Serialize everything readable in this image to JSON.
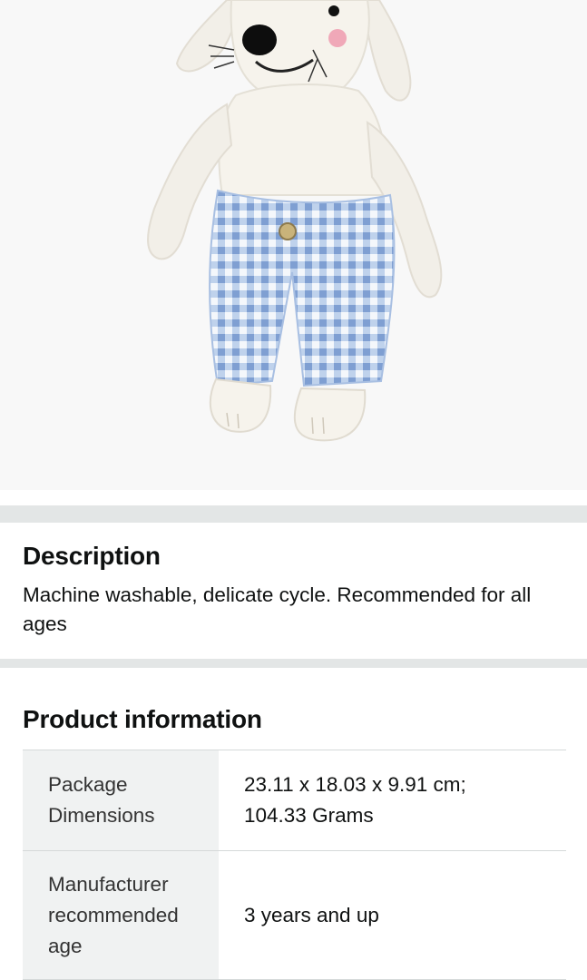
{
  "product_image": {
    "subject": "plush-toy-mouse-in-gingham-pants",
    "colors": {
      "background": "#f8f8f8",
      "fur": "#f2efe8",
      "gingham_light": "#dfe7f3",
      "gingham_dark": "#8fb0dc"
    }
  },
  "description": {
    "title": "Description",
    "text": "Machine washable, delicate cycle. Recommended for all ages"
  },
  "product_information": {
    "title": "Product information",
    "rows": [
      {
        "label": "Package Dimensions",
        "value": "23.11 x 18.03 x 9.91 cm; 104.33 Grams"
      },
      {
        "label": "Manufacturer recommended age",
        "value": "3 years and up"
      }
    ]
  }
}
